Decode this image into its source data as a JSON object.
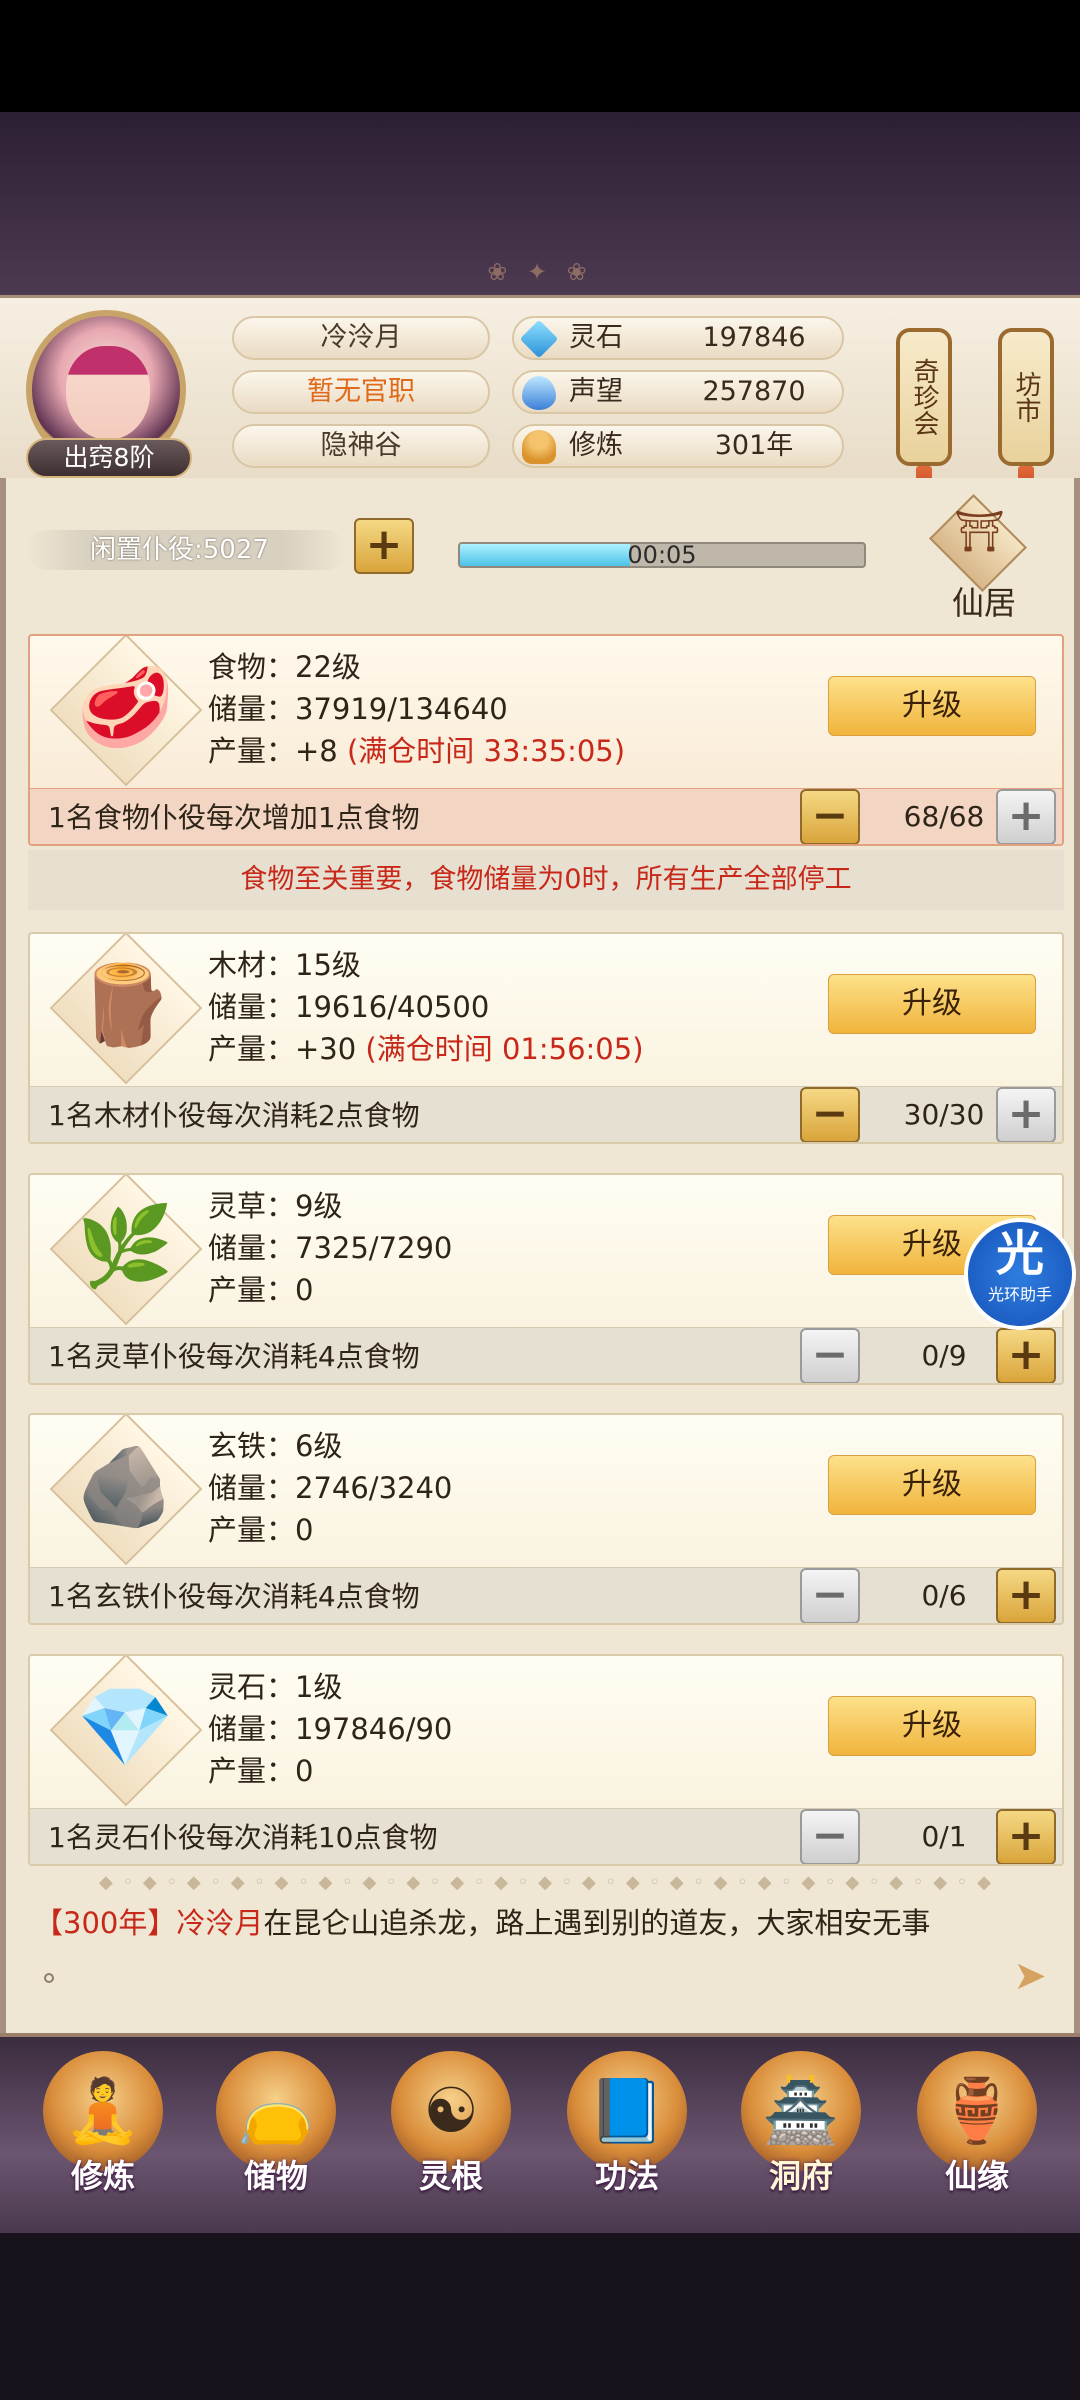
{
  "header": {
    "rank_badge": "出窍8阶",
    "name": "冷泠月",
    "official_title": "暂无官职",
    "location": "隐神谷",
    "stats": [
      {
        "label": "灵石",
        "value": "197846",
        "icon": "spirit-stone-icon"
      },
      {
        "label": "声望",
        "value": "257870",
        "icon": "reputation-drop-icon"
      },
      {
        "label": "修炼",
        "value": "301年",
        "icon": "meditation-icon"
      }
    ],
    "qizhenhui_label": "奇珍会",
    "fangshi_label": "坊市"
  },
  "idle": {
    "label": "闲置仆役:5027",
    "timer": "00:05",
    "timer_progress": 0.42
  },
  "xianju_label": "仙居",
  "cards": {
    "food": {
      "name_level": "食物：22级",
      "storage": "储量：37919/134640",
      "production": "产量：+8",
      "cap_hint": "(满仓时间 33:35:05)",
      "upgrade": "升级",
      "desc": "1名食物仆役每次增加1点食物",
      "count": "68/68",
      "icon": "meat-icon"
    },
    "food_warning": "食物至关重要，食物储量为0时，所有生产全部停工",
    "wood": {
      "name_level": "木材：15级",
      "storage": "储量：19616/40500",
      "production": "产量：+30",
      "cap_hint": "(满仓时间 01:56:05)",
      "upgrade": "升级",
      "desc": "1名木材仆役每次消耗2点食物",
      "count": "30/30",
      "icon": "log-icon"
    },
    "herb": {
      "name_level": "灵草：9级",
      "storage": "储量：7325/7290",
      "production": "产量：0",
      "upgrade": "升级",
      "desc": "1名灵草仆役每次消耗4点食物",
      "count": "0/9",
      "icon": "herb-icon"
    },
    "iron": {
      "name_level": "玄铁：6级",
      "storage": "储量：2746/3240",
      "production": "产量：0",
      "upgrade": "升级",
      "desc": "1名玄铁仆役每次消耗4点食物",
      "count": "0/6",
      "icon": "ore-icon"
    },
    "stone": {
      "name_level": "灵石：1级",
      "storage": "储量：197846/90",
      "production": "产量：0",
      "upgrade": "升级",
      "desc": "1名灵石仆役每次消耗10点食物",
      "count": "0/1",
      "icon": "crystal-icon"
    }
  },
  "log": {
    "year": "【300年】",
    "name": "冷泠月",
    "text": "在昆仑山追杀龙，路上遇到别的道友，大家相安无事"
  },
  "helper": {
    "big": "光",
    "small": "光环助手"
  },
  "nav": [
    {
      "label": "修炼",
      "icon": "cultivate-icon"
    },
    {
      "label": "储物",
      "icon": "storage-bag-icon"
    },
    {
      "label": "灵根",
      "icon": "spirit-root-icon"
    },
    {
      "label": "功法",
      "icon": "technique-book-icon"
    },
    {
      "label": "洞府",
      "icon": "cave-dwelling-icon"
    },
    {
      "label": "仙缘",
      "icon": "immortal-fate-icon"
    }
  ]
}
